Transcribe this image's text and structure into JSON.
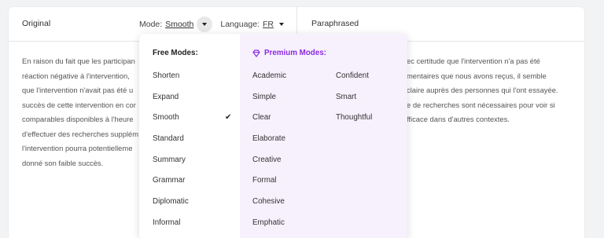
{
  "header": {
    "original_label": "Original",
    "mode_label": "Mode:",
    "mode_value": "Smooth",
    "language_label": "Language:",
    "language_value": "FR",
    "paraphrased_label": "Paraphrased"
  },
  "original_text": {
    "lines": [
      "En raison du fait que les participan",
      "réaction négative à l'intervention, ",
      "que l'intervention n'avait pas été u",
      "succès de cette intervention en cor",
      "comparables disponibles à l'heure ",
      "d'effectuer des recherches supplém",
      "l'intervention pourra potentielleme",
      "donné son faible succès."
    ]
  },
  "paraphrased_text": {
    "lines": [
      "ec certitude que l'intervention n'a pas été",
      "mentaires que nous avons reçus, il semble",
      "claire auprès des personnes qui l'ont essayée.",
      "e de recherches sont nécessaires pour voir si",
      "fficace dans d'autres contextes."
    ]
  },
  "dropdown": {
    "free_heading": "Free Modes:",
    "free_modes": [
      "Shorten",
      "Expand",
      "Smooth",
      "Standard",
      "Summary",
      "Grammar",
      "Diplomatic",
      "Informal"
    ],
    "selected_mode": "Smooth",
    "check_glyph": "✔",
    "premium_heading": "Premium Modes:",
    "premium_icon": "diamond-icon",
    "premium_col1": [
      "Academic",
      "Simple",
      "Clear",
      "Elaborate",
      "Creative",
      "Formal",
      "Cohesive",
      "Emphatic"
    ],
    "premium_col2": [
      "Confident",
      "Smart",
      "Thoughtful"
    ]
  },
  "colors": {
    "premium_accent": "#8a2be2",
    "premium_bg": "#f7f0fd"
  }
}
